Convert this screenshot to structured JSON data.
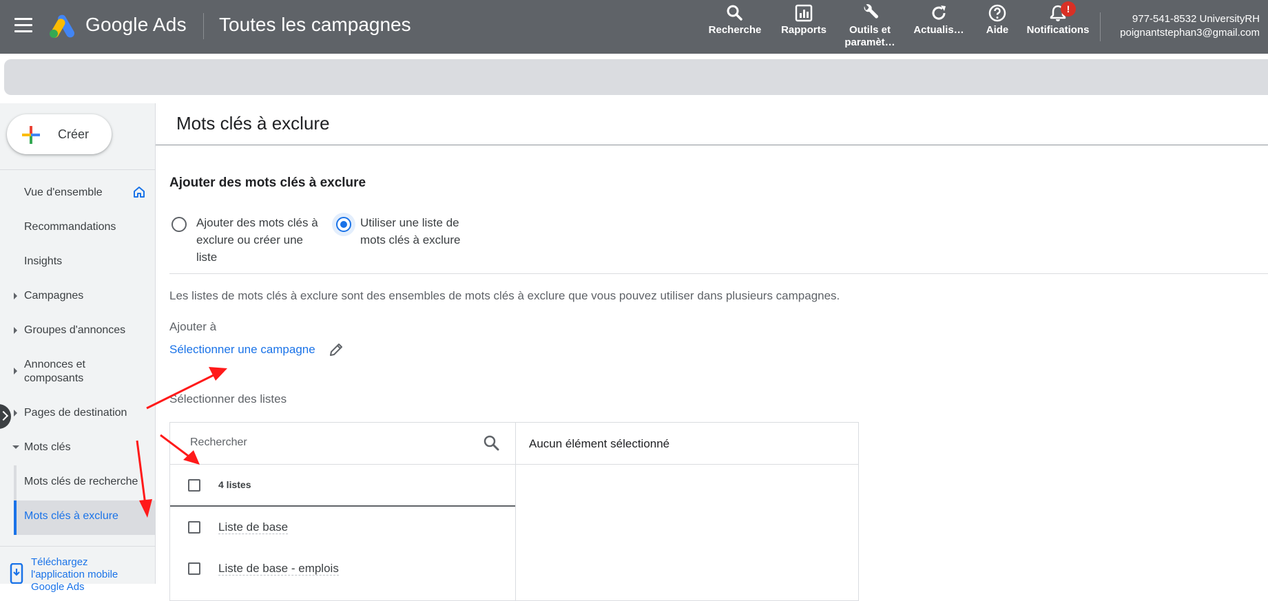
{
  "header": {
    "brand": "Google Ads",
    "page_heading": "Toutes les campagnes",
    "tools": {
      "search": "Recherche",
      "reports": "Rapports",
      "tools_line1": "Outils et",
      "tools_line2": "paramèt…",
      "refresh": "Actualis…",
      "help": "Aide",
      "notifications": "Notifications",
      "notif_badge": "!"
    },
    "account": {
      "id_name": "977-541-8532 UniversityRH",
      "email": "poignantstephan3@gmail.com"
    }
  },
  "sidebar": {
    "create_label": "Créer",
    "items": {
      "overview": "Vue d'ensemble",
      "recommendations": "Recommandations",
      "insights": "Insights",
      "campaigns": "Campagnes",
      "ad_groups": "Groupes d'annonces",
      "ads_line1": "Annonces et",
      "ads_line2": "composants",
      "landing_pages": "Pages de destination",
      "keywords": "Mots clés",
      "search_keywords": "Mots clés de recherche",
      "negative_keywords": "Mots clés à exclure"
    },
    "app_promo_line1": "Téléchargez",
    "app_promo_line2": "l'application mobile",
    "app_promo_line3": "Google Ads"
  },
  "main": {
    "title": "Mots clés à exclure",
    "section_title": "Ajouter des mots clés à exclure",
    "radio_option1_line1": "Ajouter des mots clés à",
    "radio_option1_line2": "exclure ou créer une",
    "radio_option1_line3": "liste",
    "radio_option2_line1": "Utiliser une liste de",
    "radio_option2_line2": "mots clés à exclure",
    "description": "Les listes de mots clés à exclure sont des ensembles de mots clés à exclure que vous pouvez utiliser dans plusieurs campagnes.",
    "add_to_label": "Ajouter à",
    "select_campaign_link": "Sélectionner une campagne",
    "select_lists_label": "Sélectionner des listes",
    "picker": {
      "search_placeholder": "Rechercher",
      "count_label": "4 listes",
      "lists": [
        "Liste de base",
        "Liste de base - emplois"
      ],
      "none_selected": "Aucun élément sélectionné"
    }
  },
  "colors": {
    "header_bg": "#5f6368",
    "accent_blue": "#1a73e8",
    "sidebar_bg": "#f1f3f4",
    "annotation_red": "#ff1a1a"
  }
}
